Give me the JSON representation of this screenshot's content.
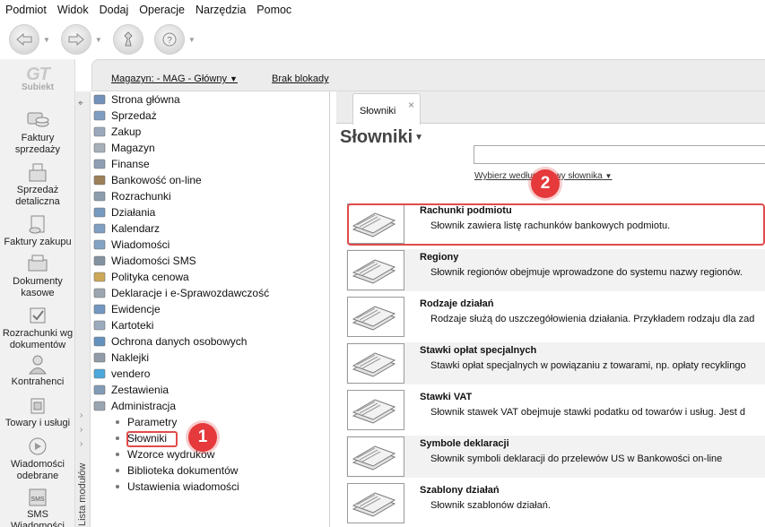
{
  "menu": [
    "Podmiot",
    "Widok",
    "Dodaj",
    "Operacje",
    "Narzędzia",
    "Pomoc"
  ],
  "toolbar": [
    {
      "icon": "back-arrow-icon",
      "has_dropdown": true
    },
    {
      "icon": "forward-arrow-icon",
      "has_dropdown": true
    },
    {
      "icon": "fixtures-icon",
      "has_dropdown": false
    },
    {
      "icon": "help-icon",
      "has_dropdown": true
    }
  ],
  "logo": {
    "text": "GT",
    "sub": "Subiekt"
  },
  "modules": [
    {
      "label": "Faktury sprzedaży",
      "icon": "coins-icon"
    },
    {
      "label": "Sprzedaż detaliczna",
      "icon": "cash-register-icon"
    },
    {
      "label": "Faktury zakupu",
      "icon": "purchase-invoice-icon"
    },
    {
      "label": "Dokumenty kasowe",
      "icon": "cash-documents-icon"
    },
    {
      "label": "Rozrachunki wg dokumentów",
      "icon": "settlements-icon"
    },
    {
      "label": "Kontrahenci",
      "icon": "person-icon"
    },
    {
      "label": "Towary i usługi",
      "icon": "goods-icon"
    },
    {
      "label": "Wiadomości odebrane",
      "icon": "messages-icon"
    },
    {
      "label": "SMS Wiadomości",
      "icon": "sms-icon"
    }
  ],
  "header": {
    "warehouse": "Magazyn: - MAG - Główny",
    "lock": "Brak blokady"
  },
  "tree": {
    "strip_label": "Lista modułów",
    "items": [
      {
        "label": "Strona główna",
        "color": "#5a7fb0"
      },
      {
        "label": "Sprzedaż",
        "color": "#6a8db8"
      },
      {
        "label": "Zakup",
        "color": "#8a9ab0"
      },
      {
        "label": "Magazyn",
        "color": "#9aa3ad"
      },
      {
        "label": "Finanse",
        "color": "#7c8ea6"
      },
      {
        "label": "Bankowość on-line",
        "color": "#8b6a3e"
      },
      {
        "label": "Rozrachunki",
        "color": "#7a8ca0"
      },
      {
        "label": "Działania",
        "color": "#5f88b5"
      },
      {
        "label": "Kalendarz",
        "color": "#6a8fb8"
      },
      {
        "label": "Wiadomości",
        "color": "#6e93bb"
      },
      {
        "label": "Wiadomości SMS",
        "color": "#6f7f90"
      },
      {
        "label": "Polityka cenowa",
        "color": "#c49a3a"
      },
      {
        "label": "Deklaracje i e-Sprawozdawczość",
        "color": "#8d96a3"
      },
      {
        "label": "Ewidencje",
        "color": "#5a86b6"
      },
      {
        "label": "Kartoteki",
        "color": "#8a9cb2"
      },
      {
        "label": "Ochrona danych osobowych",
        "color": "#4b7fb5"
      },
      {
        "label": "Naklejki",
        "color": "#7d8a98"
      },
      {
        "label": "vendero",
        "color": "#2c9ad6"
      },
      {
        "label": "Zestawienia",
        "color": "#6d8aab"
      },
      {
        "label": "Administracja",
        "color": "#8a96a4"
      }
    ],
    "sub_items": [
      "Parametry",
      "Słowniki",
      "Wzorce wydruków",
      "Biblioteka dokumentów",
      "Ustawienia wiadomości"
    ],
    "selected_sub": "Słowniki"
  },
  "tab": {
    "label": "Słowniki",
    "close": "×"
  },
  "page": {
    "title": "Słowniki",
    "search_value": "",
    "search_hint": "Wybierz według nazwy słownika"
  },
  "dictionaries": [
    {
      "title": "Rachunki podmiotu",
      "desc": "Słownik zawiera listę rachunków bankowych podmiotu."
    },
    {
      "title": "Regiony",
      "desc": "Słownik regionów obejmuje wprowadzone do systemu nazwy regionów."
    },
    {
      "title": "Rodzaje działań",
      "desc": "Rodzaje służą do uszczegółowienia działania. Przykładem rodzaju dla zad"
    },
    {
      "title": "Stawki opłat specjalnych",
      "desc": "Stawki opłat specjalnych w powiązaniu z towarami, np. opłaty recyklingo"
    },
    {
      "title": "Stawki VAT",
      "desc": "Słownik stawek VAT obejmuje stawki podatku od towarów i usług. Jest d"
    },
    {
      "title": "Symbole deklaracji",
      "desc": "Słownik symboli deklaracji do przelewów US w Bankowości on-line"
    },
    {
      "title": "Szablony działań",
      "desc": "Słownik szablonów działań."
    }
  ],
  "callouts": [
    "1",
    "2"
  ],
  "colors": {
    "accent_red": "#e5393b",
    "panel_gray": "#ececec"
  }
}
